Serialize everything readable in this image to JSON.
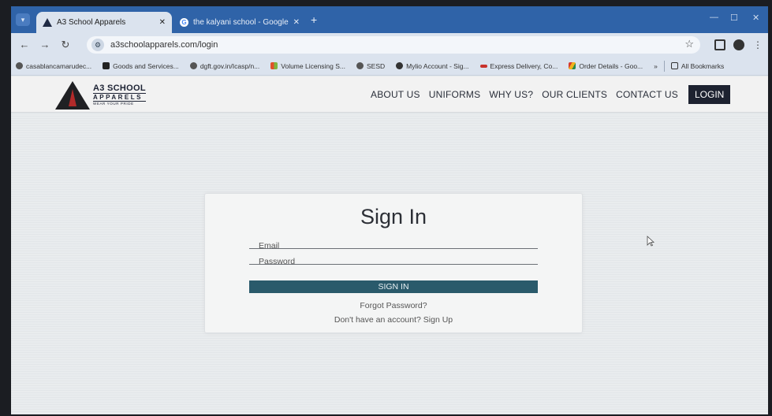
{
  "browser": {
    "tabs": [
      {
        "title": "A3 School Apparels",
        "active": true,
        "favicon": "a3-logo-icon"
      },
      {
        "title": "the kalyani school - Google Sea",
        "active": false,
        "favicon": "google-icon"
      }
    ],
    "url": "a3schoolapparels.com/login",
    "bookmarks": [
      {
        "label": "casablancamarudec...",
        "icon": "globe-icon",
        "color": "#555555"
      },
      {
        "label": "Goods and Services...",
        "icon": "gem-icon",
        "color": "#222222"
      },
      {
        "label": "dgft.gov.in/Icasp/n...",
        "icon": "globe-icon",
        "color": "#555555"
      },
      {
        "label": "Volume Licensing S...",
        "icon": "microsoft-icon",
        "color": "#e0502a"
      },
      {
        "label": "SESD",
        "icon": "globe-icon",
        "color": "#555555"
      },
      {
        "label": "Mylio Account - Sig...",
        "icon": "mylio-icon",
        "color": "#333333"
      },
      {
        "label": "Express Delivery, Co...",
        "icon": "delivery-icon",
        "color": "#c8322c"
      },
      {
        "label": "Order Details - Goo...",
        "icon": "drive-icon",
        "color": "#d63a2e"
      }
    ],
    "more_bookmarks": "»",
    "all_bookmarks": "All Bookmarks"
  },
  "site": {
    "logo": {
      "line1": "A3 SCHOOL",
      "line2": "APPARELS",
      "line3": "WEAR YOUR PRIDE"
    },
    "nav": [
      "ABOUT US",
      "UNIFORMS",
      "WHY US?",
      "OUR CLIENTS",
      "CONTACT US"
    ],
    "login_label": "LOGIN"
  },
  "signin": {
    "title": "Sign In",
    "email_placeholder": "Email",
    "password_placeholder": "Password",
    "button_label": "SIGN IN",
    "forgot_label": "Forgot Password?",
    "signup_label": "Don't have an account? Sign Up"
  },
  "colors": {
    "tabstrip": "#2f63a8",
    "signin_button": "#2a5a6b",
    "login_button": "#1d2230"
  }
}
